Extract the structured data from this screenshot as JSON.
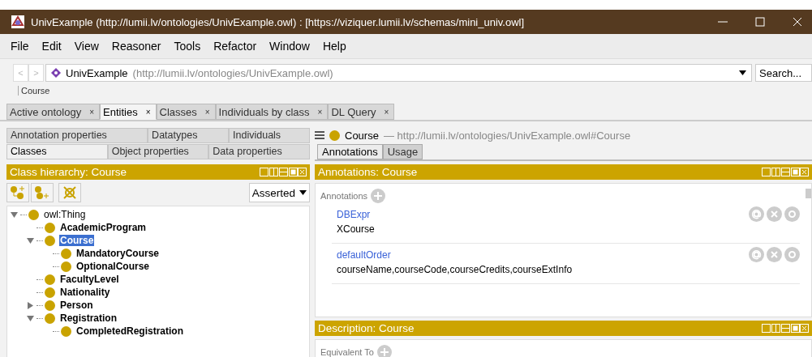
{
  "window": {
    "title": "UnivExample (http://lumii.lv/ontologies/UnivExample.owl)  : [https://viziquer.lumii.lv/schemas/mini_univ.owl]"
  },
  "menu": [
    "File",
    "Edit",
    "View",
    "Reasoner",
    "Tools",
    "Refactor",
    "Window",
    "Help"
  ],
  "nav": {
    "back": "<",
    "forward": ">",
    "ontology_name": "UnivExample",
    "ontology_iri": "(http://lumii.lv/ontologies/UnivExample.owl)",
    "search_placeholder": "Search...",
    "breadcrumb": "Course"
  },
  "tabs": [
    {
      "label": "Active ontology",
      "close": "×",
      "selected": false
    },
    {
      "label": "Entities",
      "close": "×",
      "selected": true
    },
    {
      "label": "Classes",
      "close": "×",
      "selected": false
    },
    {
      "label": "Individuals by class",
      "close": "×",
      "selected": false
    },
    {
      "label": "DL Query",
      "close": "×",
      "selected": false
    }
  ],
  "entity_tabs": [
    [
      {
        "label": "Annotation properties",
        "selected": false
      },
      {
        "label": "Datatypes",
        "selected": false
      },
      {
        "label": "Individuals",
        "selected": false
      }
    ],
    [
      {
        "label": "Classes",
        "selected": true
      },
      {
        "label": "Object properties",
        "selected": false
      },
      {
        "label": "Data properties",
        "selected": false
      }
    ]
  ],
  "class_hierarchy": {
    "title": "Class hierarchy: Course",
    "mode": "Asserted",
    "tree": [
      {
        "label": "owl:Thing",
        "bold": false,
        "selected": false,
        "expanded": true,
        "children": [
          {
            "label": "AcademicProgram",
            "bold": true,
            "selected": false
          },
          {
            "label": "Course",
            "bold": true,
            "selected": true,
            "expanded": true,
            "children": [
              {
                "label": "MandatoryCourse",
                "bold": true,
                "selected": false
              },
              {
                "label": "OptionalCourse",
                "bold": true,
                "selected": false
              }
            ]
          },
          {
            "label": "FacultyLevel",
            "bold": true,
            "selected": false
          },
          {
            "label": "Nationality",
            "bold": true,
            "selected": false
          },
          {
            "label": "Person",
            "bold": true,
            "selected": false,
            "expanded": false
          },
          {
            "label": "Registration",
            "bold": true,
            "selected": false,
            "expanded": true,
            "children": [
              {
                "label": "CompletedRegistration",
                "bold": true,
                "selected": false
              }
            ]
          }
        ]
      }
    ]
  },
  "entity": {
    "name": "Course",
    "separator": "—",
    "iri": "http://lumii.lv/ontologies/UnivExample.owl#Course"
  },
  "entity_view_tabs": [
    {
      "label": "Annotations",
      "selected": true
    },
    {
      "label": "Usage",
      "selected": false
    }
  ],
  "annotations": {
    "title": "Annotations: Course",
    "section": "Annotations",
    "items": [
      {
        "property": "DBExpr",
        "value": "XCourse"
      },
      {
        "property": "defaultOrder",
        "value": "courseName,courseCode,courseCredits,courseExtInfo"
      }
    ]
  },
  "description": {
    "title": "Description: Course",
    "section": "Equivalent To"
  }
}
